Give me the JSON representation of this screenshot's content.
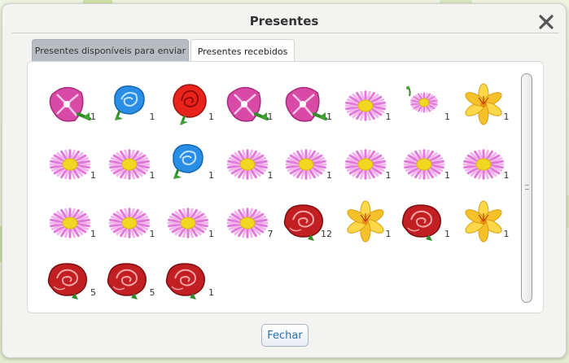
{
  "dialog": {
    "title": "Presentes",
    "close_icon": "close-icon",
    "footer_button": "Fechar"
  },
  "tabs": [
    {
      "label": "Presentes disponíveis para enviar",
      "active": false
    },
    {
      "label": "Presentes recebidos",
      "active": true
    }
  ],
  "gifts": [
    {
      "flower": "morning-glory",
      "count": "1"
    },
    {
      "flower": "blue-rose",
      "count": "1"
    },
    {
      "flower": "red-rose",
      "count": "1"
    },
    {
      "flower": "morning-glory",
      "count": "1"
    },
    {
      "flower": "morning-glory",
      "count": "1"
    },
    {
      "flower": "pink-daisy",
      "count": "1"
    },
    {
      "flower": "pink-daisy-small",
      "count": "1"
    },
    {
      "flower": "yellow-lily",
      "count": "1"
    },
    {
      "flower": "pink-daisy",
      "count": "1"
    },
    {
      "flower": "pink-daisy",
      "count": "1"
    },
    {
      "flower": "blue-rose",
      "count": "1"
    },
    {
      "flower": "pink-daisy",
      "count": "1"
    },
    {
      "flower": "pink-daisy",
      "count": "1"
    },
    {
      "flower": "pink-daisy",
      "count": "1"
    },
    {
      "flower": "pink-daisy",
      "count": "1"
    },
    {
      "flower": "pink-daisy",
      "count": "1"
    },
    {
      "flower": "pink-daisy",
      "count": "1"
    },
    {
      "flower": "pink-daisy",
      "count": "1"
    },
    {
      "flower": "pink-daisy",
      "count": "1"
    },
    {
      "flower": "pink-daisy",
      "count": "7"
    },
    {
      "flower": "dark-red-rose",
      "count": "12"
    },
    {
      "flower": "yellow-lily",
      "count": "1"
    },
    {
      "flower": "dark-red-rose",
      "count": "1"
    },
    {
      "flower": "yellow-lily",
      "count": "1"
    },
    {
      "flower": "dark-red-rose",
      "count": "5"
    },
    {
      "flower": "dark-red-rose",
      "count": "5"
    },
    {
      "flower": "dark-red-rose",
      "count": "1"
    }
  ],
  "colors": {
    "tab_inactive": "#b7bcc0",
    "button_text": "#2d6fae",
    "panel_background": "#ffffff"
  }
}
